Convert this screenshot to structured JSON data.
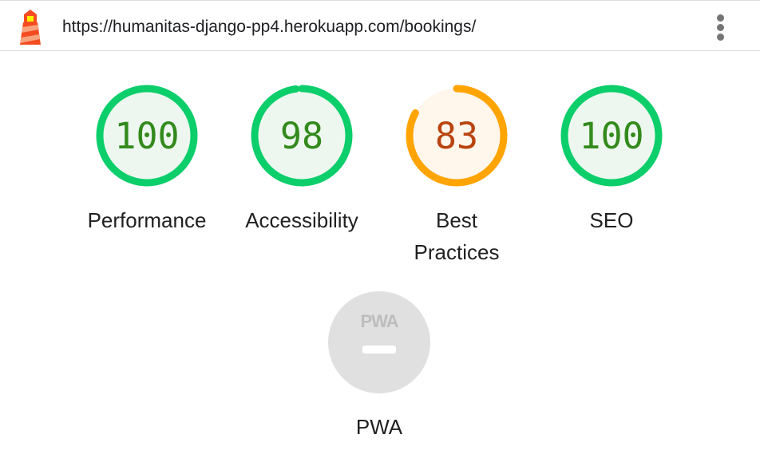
{
  "browser": {
    "url": "https://humanitas-django-pp4.herokuapp.com/bookings/"
  },
  "colors": {
    "pass": "#0cce6b",
    "pass_fill": "#edf7ef",
    "pass_text": "#338a1c",
    "average": "#ffa400",
    "average_fill": "#fff6ec",
    "average_text": "#b9440f",
    "na": "#e0e0e0",
    "na_mark": "#ffffff"
  },
  "categories": [
    {
      "id": "performance",
      "score": "100",
      "percent": 100,
      "label": "Performance",
      "rating": "pass"
    },
    {
      "id": "accessibility",
      "score": "98",
      "percent": 98,
      "label": "Accessibility",
      "rating": "pass"
    },
    {
      "id": "best-practices",
      "score": "83",
      "percent": 83,
      "label_line1": "Best",
      "label_line2": "Practices",
      "rating": "average"
    },
    {
      "id": "seo",
      "score": "100",
      "percent": 100,
      "label": "SEO",
      "rating": "pass"
    }
  ],
  "pwa": {
    "badge_text": "PWA",
    "label": "PWA"
  }
}
